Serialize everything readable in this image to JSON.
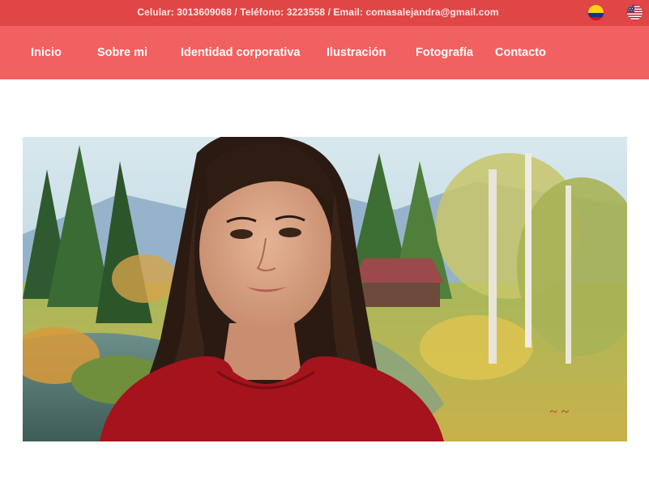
{
  "topbar": {
    "contact_text": "Celular: 3013609068 / Teléfono: 3223558 / Email: comasalejandra@gmail.com",
    "flags": [
      {
        "name": "colombia-flag-icon",
        "colors": [
          "#fcd116",
          "#003893",
          "#ce1126"
        ]
      },
      {
        "name": "usa-flag-icon",
        "colors": [
          "#b22234",
          "#ffffff",
          "#3c3b6e"
        ]
      }
    ],
    "background": "#e04646"
  },
  "nav": {
    "background": "#f26161",
    "items": [
      {
        "label": "Inicio"
      },
      {
        "label": "Sobre mi"
      },
      {
        "label": "Identidad corporativa"
      },
      {
        "label": "Ilustración"
      },
      {
        "label": "Fotografía"
      },
      {
        "label": "Contacto"
      }
    ]
  },
  "hero": {
    "image": "portrait-photo",
    "description_icon": "photo-icon"
  }
}
